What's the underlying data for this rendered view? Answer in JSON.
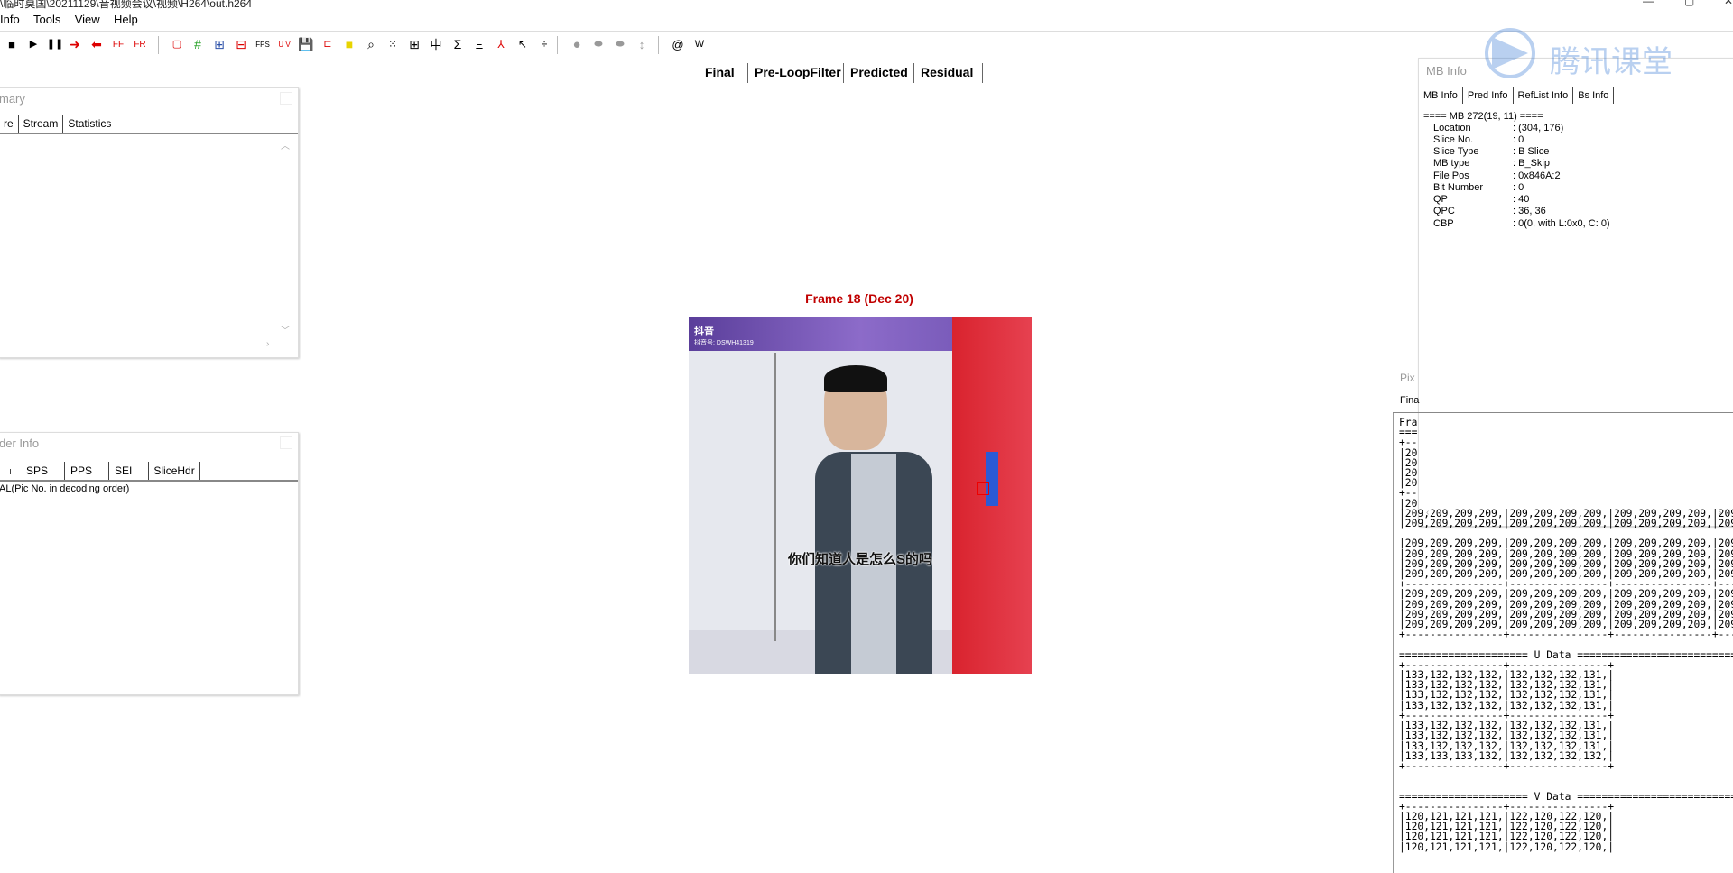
{
  "window": {
    "title": "\\临时莫国\\20211129\\音视频会议\\视频\\H264\\out.h264",
    "controls": [
      "—",
      "▢",
      "✕"
    ]
  },
  "menu": [
    "Info",
    "Tools",
    "View",
    "Help"
  ],
  "toolbar": {
    "ff": "FF",
    "fr": "FR",
    "fps": "FPS",
    "uv": "U V",
    "at": "@",
    "w": "W"
  },
  "view_tabs": [
    "Final",
    "Pre-LoopFilter",
    "Predicted",
    "Residual"
  ],
  "frame": {
    "title": "Frame 18 (Dec 20)",
    "app_name": "抖音",
    "account": "抖音号: DSWH41319",
    "subtitle": "你们知道人是怎么S的吗"
  },
  "summary_panel": {
    "title": "mary",
    "tabs": [
      "re",
      "Stream",
      "Statistics"
    ]
  },
  "decoder_panel": {
    "title": "der Info",
    "tabs": [
      "",
      "SPS",
      "PPS",
      "SEI",
      "SliceHdr"
    ],
    "content": "AL(Pic No. in decoding order)"
  },
  "mb_panel": {
    "title": "MB Info",
    "tabs": [
      "MB Info",
      "Pred Info",
      "RefList Info",
      "Bs Info"
    ],
    "header": "==== MB 272(19, 11) ====",
    "rows": [
      {
        "k": "Location",
        "v": ": (304, 176)"
      },
      {
        "k": "Slice No.",
        "v": ": 0"
      },
      {
        "k": "Slice Type",
        "v": ": B Slice"
      },
      {
        "k": "MB type",
        "v": ": B_Skip"
      },
      {
        "k": "File Pos",
        "v": ": 0x846A:2"
      },
      {
        "k": "Bit Number",
        "v": ": 0"
      },
      {
        "k": "QP",
        "v": ": 40"
      },
      {
        "k": "QPC",
        "v": ": 36, 36"
      },
      {
        "k": "CBP",
        "v": ": 0(0, with L:0x0, C: 0)"
      }
    ]
  },
  "pixel_panel": {
    "title": "Pix",
    "tab": "Fina",
    "lines": [
      "Fra",
      "===",
      "+--",
      "|20",
      "|20",
      "|20",
      "|20",
      "+--",
      "|20",
      "|209,209,209,209,|209,209,209,209,|209,209,209,209,|209,209,209,20",
      "|209,209,209,209,|209,209,209,209,|209,209,209,209,|209,209,209,20",
      "",
      "|209,209,209,209,|209,209,209,209,|209,209,209,209,|209,209,209,20",
      "|209,209,209,209,|209,209,209,209,|209,209,209,209,|209,209,209,20",
      "|209,209,209,209,|209,209,209,209,|209,209,209,209,|209,209,209,20",
      "|209,209,209,209,|209,209,209,209,|209,209,209,209,|209,209,209,20",
      "+----------------+----------------+----------------+--------------",
      "|209,209,209,209,|209,209,209,209,|209,209,209,209,|209,209,209,20",
      "|209,209,209,209,|209,209,209,209,|209,209,209,209,|209,209,209,20",
      "|209,209,209,209,|209,209,209,209,|209,209,209,209,|209,209,209,20",
      "|209,209,209,209,|209,209,209,209,|209,209,209,209,|209,209,209,20",
      "+----------------+----------------+----------------+--------------",
      "",
      "===================== U Data ======================================",
      "+----------------+----------------+",
      "|133,132,132,132,|132,132,132,131,|",
      "|133,132,132,132,|132,132,132,131,|",
      "|133,132,132,132,|132,132,132,131,|",
      "|133,132,132,132,|132,132,132,131,|",
      "+----------------+----------------+",
      "|133,132,132,132,|132,132,132,131,|",
      "|133,132,132,132,|132,132,132,131,|",
      "|133,132,132,132,|132,132,132,131,|",
      "|133,133,133,132,|132,132,132,132,|",
      "+----------------+----------------+",
      "",
      "",
      "===================== V Data ======================================",
      "+----------------+----------------+",
      "|120,121,121,121,|122,120,122,120,|",
      "|120,121,121,121,|122,120,122,120,|",
      "|120,121,121,121,|122,120,122,120,|",
      "|120,121,121,121,|122,120,122,120,|"
    ]
  },
  "watermark": {
    "text": "腾讯课堂"
  },
  "colors": {
    "accent_red": "#c00000",
    "tab_border": "#888888"
  }
}
